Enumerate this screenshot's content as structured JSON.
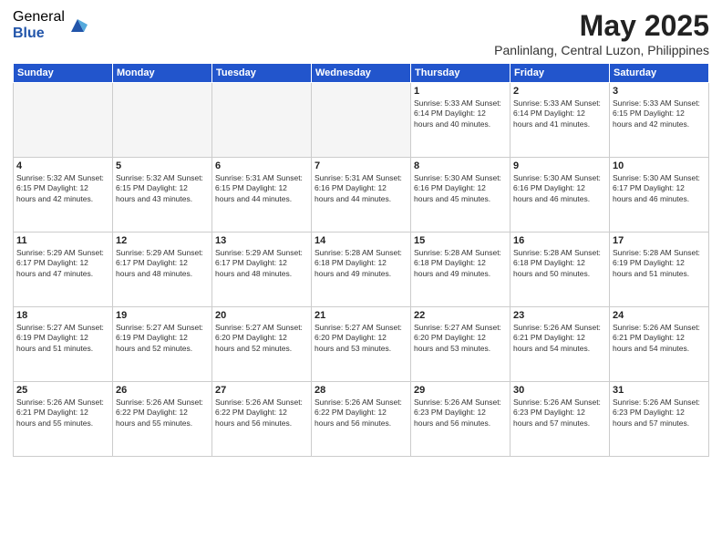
{
  "logo": {
    "general": "General",
    "blue": "Blue"
  },
  "title": {
    "month_year": "May 2025",
    "location": "Panlinlang, Central Luzon, Philippines"
  },
  "days_header": [
    "Sunday",
    "Monday",
    "Tuesday",
    "Wednesday",
    "Thursday",
    "Friday",
    "Saturday"
  ],
  "weeks": [
    [
      {
        "day": "",
        "info": ""
      },
      {
        "day": "",
        "info": ""
      },
      {
        "day": "",
        "info": ""
      },
      {
        "day": "",
        "info": ""
      },
      {
        "day": "1",
        "info": "Sunrise: 5:33 AM\nSunset: 6:14 PM\nDaylight: 12 hours\nand 40 minutes."
      },
      {
        "day": "2",
        "info": "Sunrise: 5:33 AM\nSunset: 6:14 PM\nDaylight: 12 hours\nand 41 minutes."
      },
      {
        "day": "3",
        "info": "Sunrise: 5:33 AM\nSunset: 6:15 PM\nDaylight: 12 hours\nand 42 minutes."
      }
    ],
    [
      {
        "day": "4",
        "info": "Sunrise: 5:32 AM\nSunset: 6:15 PM\nDaylight: 12 hours\nand 42 minutes."
      },
      {
        "day": "5",
        "info": "Sunrise: 5:32 AM\nSunset: 6:15 PM\nDaylight: 12 hours\nand 43 minutes."
      },
      {
        "day": "6",
        "info": "Sunrise: 5:31 AM\nSunset: 6:15 PM\nDaylight: 12 hours\nand 44 minutes."
      },
      {
        "day": "7",
        "info": "Sunrise: 5:31 AM\nSunset: 6:16 PM\nDaylight: 12 hours\nand 44 minutes."
      },
      {
        "day": "8",
        "info": "Sunrise: 5:30 AM\nSunset: 6:16 PM\nDaylight: 12 hours\nand 45 minutes."
      },
      {
        "day": "9",
        "info": "Sunrise: 5:30 AM\nSunset: 6:16 PM\nDaylight: 12 hours\nand 46 minutes."
      },
      {
        "day": "10",
        "info": "Sunrise: 5:30 AM\nSunset: 6:17 PM\nDaylight: 12 hours\nand 46 minutes."
      }
    ],
    [
      {
        "day": "11",
        "info": "Sunrise: 5:29 AM\nSunset: 6:17 PM\nDaylight: 12 hours\nand 47 minutes."
      },
      {
        "day": "12",
        "info": "Sunrise: 5:29 AM\nSunset: 6:17 PM\nDaylight: 12 hours\nand 48 minutes."
      },
      {
        "day": "13",
        "info": "Sunrise: 5:29 AM\nSunset: 6:17 PM\nDaylight: 12 hours\nand 48 minutes."
      },
      {
        "day": "14",
        "info": "Sunrise: 5:28 AM\nSunset: 6:18 PM\nDaylight: 12 hours\nand 49 minutes."
      },
      {
        "day": "15",
        "info": "Sunrise: 5:28 AM\nSunset: 6:18 PM\nDaylight: 12 hours\nand 49 minutes."
      },
      {
        "day": "16",
        "info": "Sunrise: 5:28 AM\nSunset: 6:18 PM\nDaylight: 12 hours\nand 50 minutes."
      },
      {
        "day": "17",
        "info": "Sunrise: 5:28 AM\nSunset: 6:19 PM\nDaylight: 12 hours\nand 51 minutes."
      }
    ],
    [
      {
        "day": "18",
        "info": "Sunrise: 5:27 AM\nSunset: 6:19 PM\nDaylight: 12 hours\nand 51 minutes."
      },
      {
        "day": "19",
        "info": "Sunrise: 5:27 AM\nSunset: 6:19 PM\nDaylight: 12 hours\nand 52 minutes."
      },
      {
        "day": "20",
        "info": "Sunrise: 5:27 AM\nSunset: 6:20 PM\nDaylight: 12 hours\nand 52 minutes."
      },
      {
        "day": "21",
        "info": "Sunrise: 5:27 AM\nSunset: 6:20 PM\nDaylight: 12 hours\nand 53 minutes."
      },
      {
        "day": "22",
        "info": "Sunrise: 5:27 AM\nSunset: 6:20 PM\nDaylight: 12 hours\nand 53 minutes."
      },
      {
        "day": "23",
        "info": "Sunrise: 5:26 AM\nSunset: 6:21 PM\nDaylight: 12 hours\nand 54 minutes."
      },
      {
        "day": "24",
        "info": "Sunrise: 5:26 AM\nSunset: 6:21 PM\nDaylight: 12 hours\nand 54 minutes."
      }
    ],
    [
      {
        "day": "25",
        "info": "Sunrise: 5:26 AM\nSunset: 6:21 PM\nDaylight: 12 hours\nand 55 minutes."
      },
      {
        "day": "26",
        "info": "Sunrise: 5:26 AM\nSunset: 6:22 PM\nDaylight: 12 hours\nand 55 minutes."
      },
      {
        "day": "27",
        "info": "Sunrise: 5:26 AM\nSunset: 6:22 PM\nDaylight: 12 hours\nand 56 minutes."
      },
      {
        "day": "28",
        "info": "Sunrise: 5:26 AM\nSunset: 6:22 PM\nDaylight: 12 hours\nand 56 minutes."
      },
      {
        "day": "29",
        "info": "Sunrise: 5:26 AM\nSunset: 6:23 PM\nDaylight: 12 hours\nand 56 minutes."
      },
      {
        "day": "30",
        "info": "Sunrise: 5:26 AM\nSunset: 6:23 PM\nDaylight: 12 hours\nand 57 minutes."
      },
      {
        "day": "31",
        "info": "Sunrise: 5:26 AM\nSunset: 6:23 PM\nDaylight: 12 hours\nand 57 minutes."
      }
    ]
  ]
}
